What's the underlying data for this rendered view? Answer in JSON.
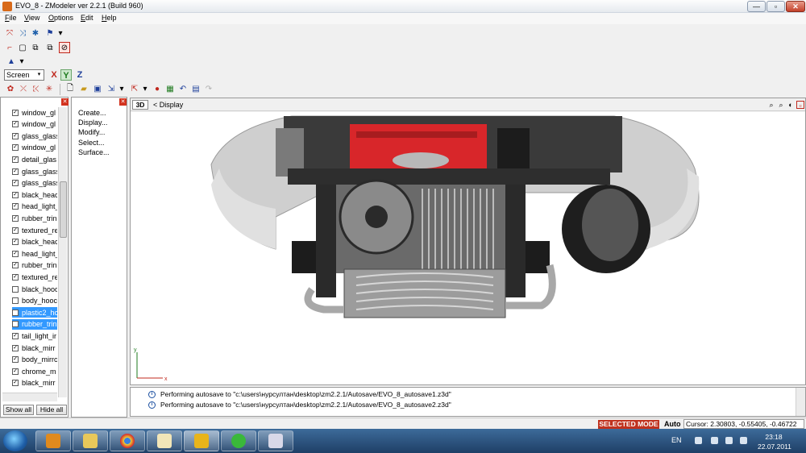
{
  "window": {
    "title": "EVO_8 - ZModeler ver 2.2.1 (Build 960)",
    "min": "—",
    "max": "▫",
    "close": "✕"
  },
  "menu": [
    "File",
    "View",
    "Options",
    "Edit",
    "Help"
  ],
  "view_select": {
    "value": "Screen",
    "arrow": "▾"
  },
  "axes": [
    "X",
    "Y",
    "Z"
  ],
  "axis_colors": {
    "x": "#c0281e",
    "y": "#1e7a1e",
    "z": "#1e3f9a"
  },
  "objects": [
    {
      "label": "window_gl",
      "checked": true,
      "selected": false
    },
    {
      "label": "window_gl",
      "checked": true,
      "selected": false
    },
    {
      "label": "glass_glass",
      "checked": true,
      "selected": false
    },
    {
      "label": "window_gl",
      "checked": true,
      "selected": false
    },
    {
      "label": "detail_glas",
      "checked": true,
      "selected": false
    },
    {
      "label": "glass_glass",
      "checked": true,
      "selected": false
    },
    {
      "label": "glass_glass",
      "checked": true,
      "selected": false
    },
    {
      "label": "black_heac",
      "checked": true,
      "selected": false
    },
    {
      "label": "head_light_",
      "checked": true,
      "selected": false
    },
    {
      "label": "rubber_trin",
      "checked": true,
      "selected": false
    },
    {
      "label": "textured_re",
      "checked": true,
      "selected": false
    },
    {
      "label": "black_heac",
      "checked": true,
      "selected": false
    },
    {
      "label": "head_light_",
      "checked": true,
      "selected": false
    },
    {
      "label": "rubber_trin",
      "checked": true,
      "selected": false
    },
    {
      "label": "textured_re",
      "checked": true,
      "selected": false
    },
    {
      "label": "black_hood",
      "checked": false,
      "selected": false
    },
    {
      "label": "body_hooc",
      "checked": false,
      "selected": false
    },
    {
      "label": "plastic2_hc",
      "checked": false,
      "selected": true
    },
    {
      "label": "rubber_trin",
      "checked": false,
      "selected": true
    },
    {
      "label": "tail_light_ir",
      "checked": true,
      "selected": false
    },
    {
      "label": "black_mirr",
      "checked": true,
      "selected": false
    },
    {
      "label": "body_mirrc",
      "checked": true,
      "selected": false
    },
    {
      "label": "chrome_m",
      "checked": true,
      "selected": false
    },
    {
      "label": "black_mirr",
      "checked": true,
      "selected": false
    }
  ],
  "list_buttons": {
    "show_all": "Show all",
    "hide_all": "Hide all"
  },
  "commands": [
    "Create...",
    "Display...",
    "Modify...",
    "Select...",
    "Surface..."
  ],
  "viewport": {
    "mode_button": "3D",
    "mode_label": "<  Display"
  },
  "log": [
    "Performing autosave to \"c:\\users\\нурсултан\\desktop\\zm2.2.1/Autosave/EVO_8_autosave1.z3d\"",
    "Performing autosave to \"c:\\users\\нурсултан\\desktop\\zm2.2.1/Autosave/EVO_8_autosave2.z3d\""
  ],
  "status": {
    "mode": "SELECTED MODE",
    "auto": "Auto",
    "cursor": "Cursor: 2.30803, -0.55405, -0.46722"
  },
  "taskbar": {
    "lang": "EN",
    "time": "23:18",
    "date": "22.07.2011",
    "apps": [
      "media-player-icon",
      "explorer-icon",
      "chrome-icon",
      "mail-icon",
      "zmodeler-icon",
      "game-icon",
      "paint-icon"
    ]
  }
}
